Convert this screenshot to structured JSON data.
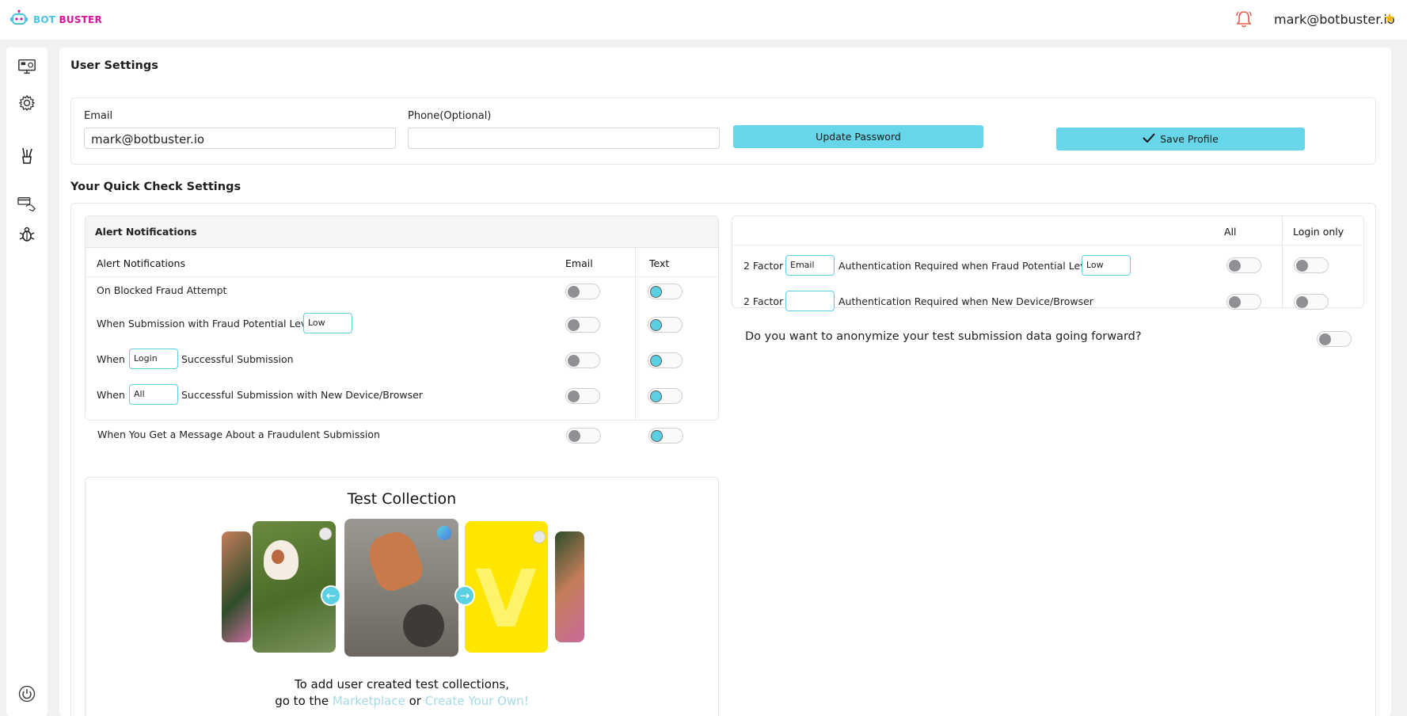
{
  "header": {
    "logo_part1": "BOT",
    "logo_part2": "BUSTER",
    "user_email": "mark@botbuster.io",
    "star": "★"
  },
  "sidebar": {
    "icons": [
      "monitor-dashboard-icon",
      "gear-icon",
      "brush-tool-icon",
      "card-hand-icon",
      "bug-icon"
    ],
    "logout_icon": "power-icon"
  },
  "user_settings": {
    "title": "User Settings",
    "email_label": "Email",
    "email_value": "mark@botbuster.io",
    "phone_label": "Phone(Optional)",
    "phone_value": "",
    "update_password_label": "Update Password",
    "save_profile_label": "Save Profile"
  },
  "quick_check": {
    "title": "Your Quick Check Settings",
    "alert_card_title": "Alert Notifications",
    "columns": {
      "name": "Alert Notifications",
      "email": "Email",
      "text": "Text"
    },
    "rows": [
      {
        "pre": "On Blocked Fraud Attempt",
        "select": "",
        "post": "",
        "email_on": false,
        "text_on": true
      },
      {
        "pre": "When Submission with Fraud Potential Level",
        "select": "Low",
        "post": "",
        "email_on": false,
        "text_on": true
      },
      {
        "pre": "When",
        "select": "Login",
        "post": "Successful Submission",
        "email_on": false,
        "text_on": true
      },
      {
        "pre": "When",
        "select": "All",
        "post": "Successful Submission with New Device/Browser",
        "email_on": false,
        "text_on": true
      },
      {
        "pre": "When You Get a Message About a Fraudulent Submission",
        "select": "",
        "post": "",
        "email_on": false,
        "text_on": true
      }
    ]
  },
  "two_factor": {
    "col_all": "All",
    "col_login": "Login only",
    "rows": [
      {
        "pre": "2 Factor",
        "method": "Email",
        "mid": "Authentication Required when Fraud Potential Level",
        "level": "Low",
        "all_on": false,
        "login_on": false
      },
      {
        "pre": "2 Factor",
        "method": "",
        "mid": "Authentication Required when New Device/Browser",
        "level": "",
        "all_on": false,
        "login_on": false
      }
    ]
  },
  "anonymize": {
    "question": "Do you want to anonymize your test submission data going forward?",
    "on": false
  },
  "test_collection": {
    "title": "Test Collection",
    "note_line1": "To add user created test collections,",
    "note_prefix": "go to the",
    "marketplace_link": "Marketplace",
    "or_text": "or",
    "create_link": "Create Your Own!",
    "prev_icon": "arrow-left-icon",
    "next_icon": "arrow-right-icon"
  }
}
